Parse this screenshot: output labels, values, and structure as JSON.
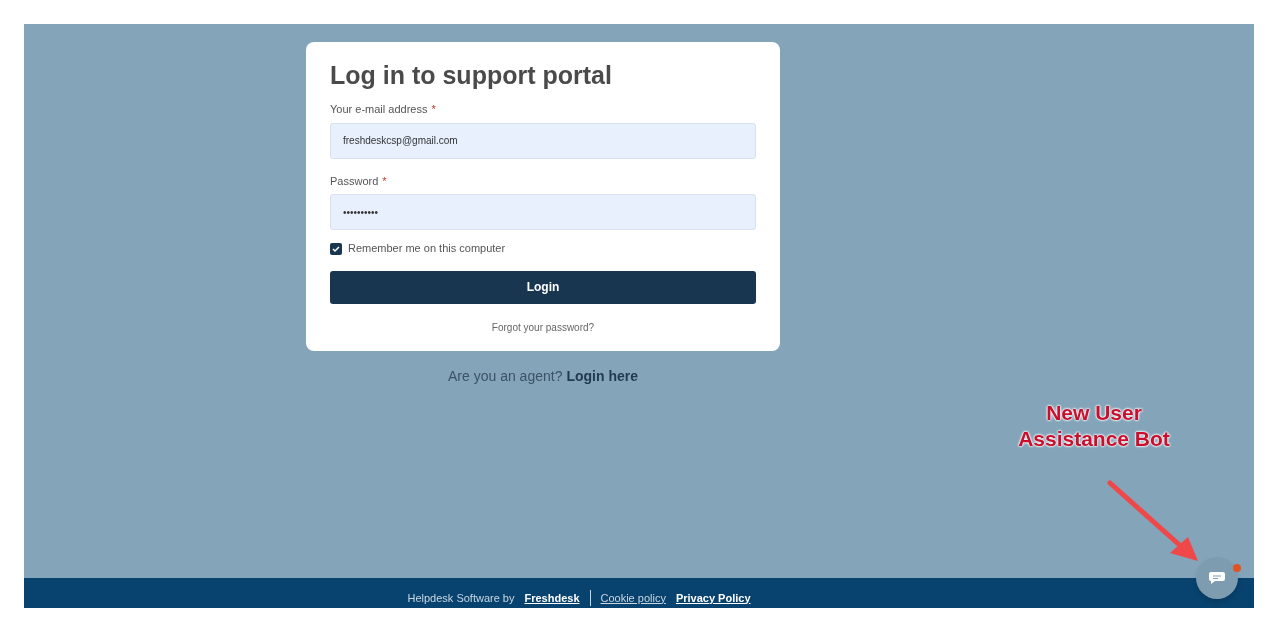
{
  "login_card": {
    "title": "Log in to support portal",
    "email": {
      "label": "Your e-mail address",
      "required_mark": "*",
      "value": "freshdeskcsp@gmail.com"
    },
    "password": {
      "label": "Password",
      "required_mark": "*",
      "value": "••••••••••"
    },
    "remember": {
      "label": "Remember me on this computer",
      "checked": true
    },
    "login_button": "Login",
    "forgot_link": "Forgot your password?"
  },
  "agent_prompt": {
    "text": "Are you an agent?",
    "link": "Login here"
  },
  "footer": {
    "text": "Helpdesk Software by",
    "links": [
      "Freshdesk",
      "Cookie policy",
      "Privacy Policy"
    ]
  },
  "annotation": {
    "text": "New User Assistance Bot"
  }
}
